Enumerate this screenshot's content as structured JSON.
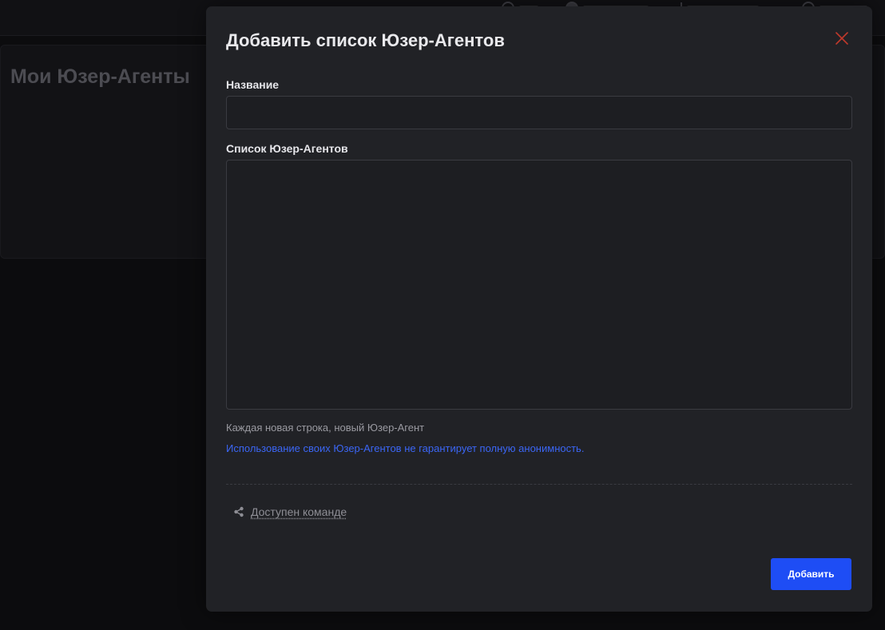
{
  "background": {
    "page_title": "Мои Юзер-Агенты"
  },
  "modal": {
    "title": "Добавить список Юзер-Агентов",
    "name_field": {
      "label": "Название",
      "value": "",
      "placeholder": ""
    },
    "ua_list_field": {
      "label": "Список Юзер-Агентов",
      "value": "",
      "placeholder": ""
    },
    "hint": "Каждая новая строка, новый Юзер-Агент",
    "warning": "Использование своих Юзер-Агентов не гарантирует полную анонимность.",
    "team_share": {
      "label": "Доступен команде",
      "icon": "share-icon"
    },
    "submit_label": "Добавить"
  },
  "colors": {
    "accent": "#1e4df5",
    "link": "#3b66f5",
    "close": "#c0392b",
    "modal_bg": "#212226",
    "page_bg": "#0c0c0e"
  }
}
